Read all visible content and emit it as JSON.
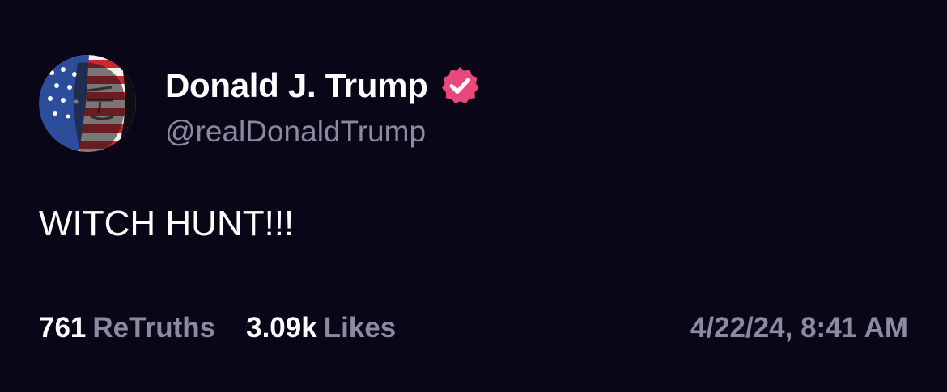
{
  "post": {
    "author": {
      "display_name": "Donald J. Trump",
      "handle": "@realDonaldTrump",
      "verified": true,
      "verified_badge_color": "#e8497a"
    },
    "text": "WITCH HUNT!!!",
    "stats": {
      "retruths_count": "761",
      "retruths_label": "ReTruths",
      "likes_count": "3.09k",
      "likes_label": "Likes"
    },
    "timestamp": "4/22/24, 8:41 AM"
  },
  "colors": {
    "background": "#0a0618",
    "text_primary": "#ffffff",
    "text_secondary": "#8e8a9e"
  }
}
